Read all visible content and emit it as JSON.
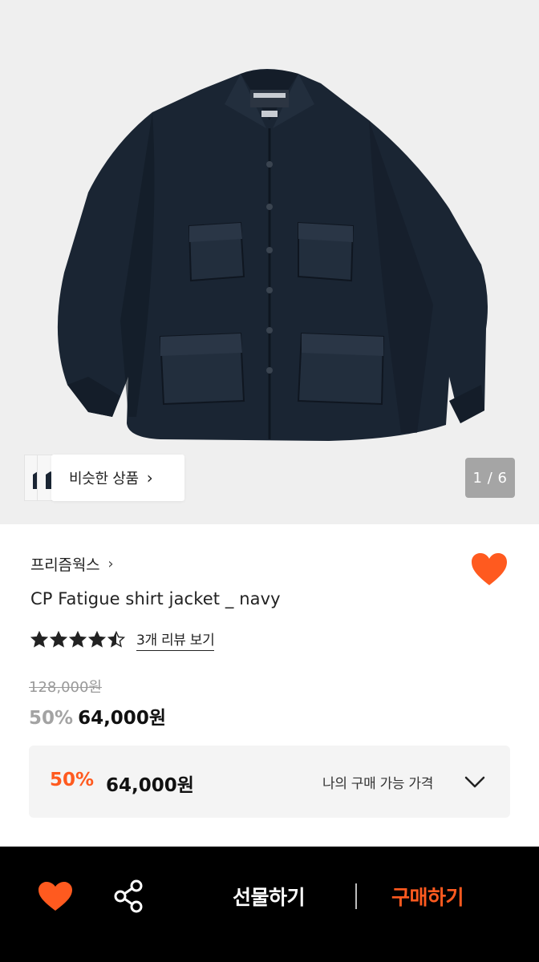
{
  "gallery": {
    "counter": "1 / 6",
    "similar_label": "비슷한 상품",
    "similar_chevron": "›"
  },
  "product": {
    "brand": "프리즘웍스",
    "brand_chevron": "›",
    "title": "CP Fatigue shirt jacket _ navy",
    "rating": 4.5,
    "review_link": "3개 리뷰 보기",
    "original_price": "128,000원",
    "discount": "50%",
    "sale_price": "64,000원"
  },
  "my_price": {
    "discount": "50%",
    "price": "64,000원",
    "label": "나의 구매 가능 가격"
  },
  "bottom_bar": {
    "gift_label": "선물하기",
    "buy_label": "구매하기"
  },
  "icons": {
    "wishlist": "heart-icon",
    "share": "share-icon",
    "dropdown": "chevron-down-icon",
    "rating": "star-icon"
  },
  "colors": {
    "accent": "#ff5a1f",
    "jacket": "#1a2533",
    "bottom_bar": "#000000"
  }
}
